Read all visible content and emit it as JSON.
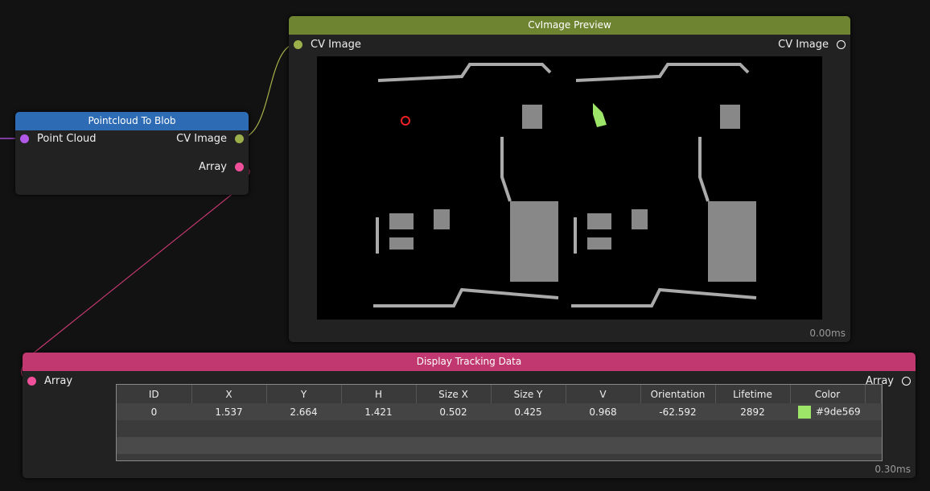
{
  "nodes": {
    "pointcloud": {
      "title": "Pointcloud To Blob",
      "inputs": [
        "Point Cloud"
      ],
      "outputs": [
        "CV Image",
        "Array"
      ],
      "color": "#2d6bb5"
    },
    "preview": {
      "title": "CvImage Preview",
      "input": "CV Image",
      "output": "CV Image",
      "time": "0.00ms",
      "color": "#6e8431"
    },
    "tracking": {
      "title": "Display Tracking Data",
      "input": "Array",
      "output": "Array",
      "time": "0.30ms",
      "color": "#c0386f",
      "columns": [
        "ID",
        "X",
        "Y",
        "H",
        "Size X",
        "Size Y",
        "V",
        "Orientation",
        "Lifetime",
        "Color"
      ],
      "rows": [
        [
          "0",
          "1.537",
          "2.664",
          "1.421",
          "0.502",
          "0.425",
          "0.968",
          "-62.592",
          "2892",
          "#9de569"
        ]
      ]
    }
  }
}
